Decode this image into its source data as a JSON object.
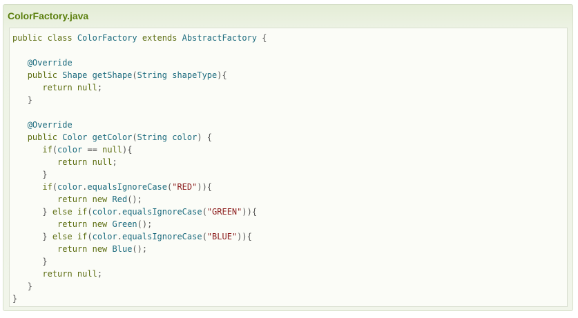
{
  "file": {
    "title": "ColorFactory.java"
  },
  "colors": {
    "title": "#5b7f0e",
    "keyword": "#5d6e12",
    "identifier": "#1c6b7e",
    "punctuation": "#555555",
    "string": "#8b1b1b",
    "panel_background": "#eef3e6",
    "code_background": "#fbfcf7"
  },
  "code": {
    "lines": [
      [
        {
          "t": "kw",
          "v": "public class "
        },
        {
          "t": "id",
          "v": "ColorFactory "
        },
        {
          "t": "kw",
          "v": "extends "
        },
        {
          "t": "id",
          "v": "AbstractFactory "
        },
        {
          "t": "p",
          "v": "{"
        }
      ],
      [],
      [
        {
          "t": "ws",
          "v": "   "
        },
        {
          "t": "ann",
          "v": "@Override"
        }
      ],
      [
        {
          "t": "ws",
          "v": "   "
        },
        {
          "t": "kw",
          "v": "public "
        },
        {
          "t": "id",
          "v": "Shape getShape"
        },
        {
          "t": "p",
          "v": "("
        },
        {
          "t": "id",
          "v": "String shapeType"
        },
        {
          "t": "p",
          "v": "){"
        }
      ],
      [
        {
          "t": "ws",
          "v": "      "
        },
        {
          "t": "kw",
          "v": "return null"
        },
        {
          "t": "p",
          "v": ";"
        }
      ],
      [
        {
          "t": "ws",
          "v": "   "
        },
        {
          "t": "p",
          "v": "}"
        }
      ],
      [],
      [
        {
          "t": "ws",
          "v": "   "
        },
        {
          "t": "ann",
          "v": "@Override"
        }
      ],
      [
        {
          "t": "ws",
          "v": "   "
        },
        {
          "t": "kw",
          "v": "public "
        },
        {
          "t": "id",
          "v": "Color getColor"
        },
        {
          "t": "p",
          "v": "("
        },
        {
          "t": "id",
          "v": "String color"
        },
        {
          "t": "p",
          "v": ") {"
        }
      ],
      [
        {
          "t": "ws",
          "v": "      "
        },
        {
          "t": "kw",
          "v": "if"
        },
        {
          "t": "p",
          "v": "("
        },
        {
          "t": "id",
          "v": "color "
        },
        {
          "t": "p",
          "v": "== "
        },
        {
          "t": "kw",
          "v": "null"
        },
        {
          "t": "p",
          "v": "){"
        }
      ],
      [
        {
          "t": "ws",
          "v": "         "
        },
        {
          "t": "kw",
          "v": "return null"
        },
        {
          "t": "p",
          "v": ";"
        }
      ],
      [
        {
          "t": "ws",
          "v": "      "
        },
        {
          "t": "p",
          "v": "}"
        }
      ],
      [
        {
          "t": "ws",
          "v": "      "
        },
        {
          "t": "kw",
          "v": "if"
        },
        {
          "t": "p",
          "v": "("
        },
        {
          "t": "id",
          "v": "color"
        },
        {
          "t": "p",
          "v": "."
        },
        {
          "t": "id",
          "v": "equalsIgnoreCase"
        },
        {
          "t": "p",
          "v": "("
        },
        {
          "t": "str",
          "v": "\"RED\""
        },
        {
          "t": "p",
          "v": ")){"
        }
      ],
      [
        {
          "t": "ws",
          "v": "         "
        },
        {
          "t": "kw",
          "v": "return new "
        },
        {
          "t": "id",
          "v": "Red"
        },
        {
          "t": "p",
          "v": "();"
        }
      ],
      [
        {
          "t": "ws",
          "v": "      "
        },
        {
          "t": "p",
          "v": "} "
        },
        {
          "t": "kw",
          "v": "else if"
        },
        {
          "t": "p",
          "v": "("
        },
        {
          "t": "id",
          "v": "color"
        },
        {
          "t": "p",
          "v": "."
        },
        {
          "t": "id",
          "v": "equalsIgnoreCase"
        },
        {
          "t": "p",
          "v": "("
        },
        {
          "t": "str",
          "v": "\"GREEN\""
        },
        {
          "t": "p",
          "v": ")){"
        }
      ],
      [
        {
          "t": "ws",
          "v": "         "
        },
        {
          "t": "kw",
          "v": "return new "
        },
        {
          "t": "id",
          "v": "Green"
        },
        {
          "t": "p",
          "v": "();"
        }
      ],
      [
        {
          "t": "ws",
          "v": "      "
        },
        {
          "t": "p",
          "v": "} "
        },
        {
          "t": "kw",
          "v": "else if"
        },
        {
          "t": "p",
          "v": "("
        },
        {
          "t": "id",
          "v": "color"
        },
        {
          "t": "p",
          "v": "."
        },
        {
          "t": "id",
          "v": "equalsIgnoreCase"
        },
        {
          "t": "p",
          "v": "("
        },
        {
          "t": "str",
          "v": "\"BLUE\""
        },
        {
          "t": "p",
          "v": ")){"
        }
      ],
      [
        {
          "t": "ws",
          "v": "         "
        },
        {
          "t": "kw",
          "v": "return new "
        },
        {
          "t": "id",
          "v": "Blue"
        },
        {
          "t": "p",
          "v": "();"
        }
      ],
      [
        {
          "t": "ws",
          "v": "      "
        },
        {
          "t": "p",
          "v": "}"
        }
      ],
      [
        {
          "t": "ws",
          "v": "      "
        },
        {
          "t": "kw",
          "v": "return null"
        },
        {
          "t": "p",
          "v": ";"
        }
      ],
      [
        {
          "t": "ws",
          "v": "   "
        },
        {
          "t": "p",
          "v": "}"
        }
      ],
      [
        {
          "t": "p",
          "v": "}"
        }
      ]
    ]
  }
}
